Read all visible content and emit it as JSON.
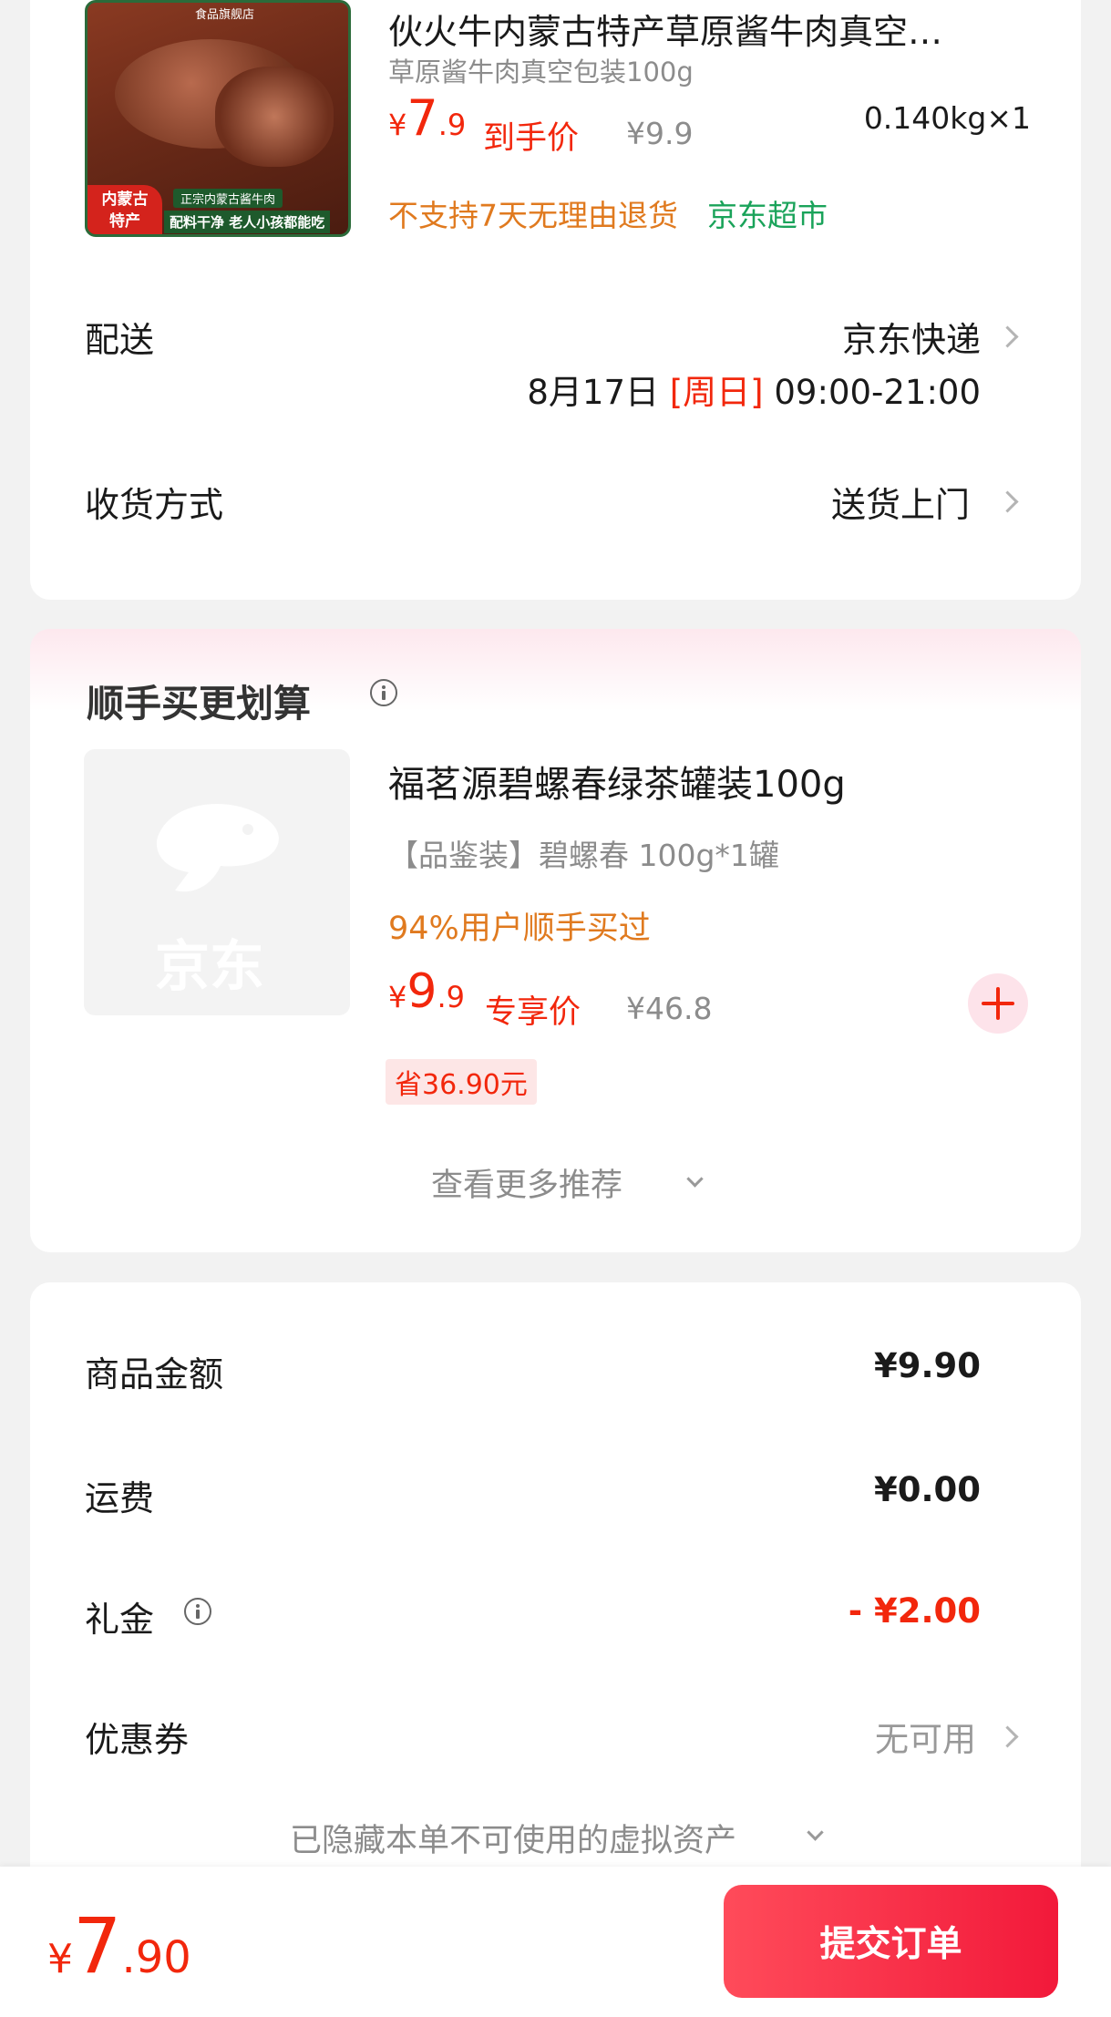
{
  "product": {
    "title": "伙火牛内蒙古特产草原酱牛肉真空…",
    "spec": "草原酱牛肉真空包装100g",
    "price_symbol": "¥",
    "price_int": "7",
    "price_dec": ".9",
    "price_tag": "到手价",
    "original_price": "¥9.9",
    "weight_qty": "0.140kg×1",
    "return_policy": "不支持7天无理由退货",
    "store_tag": "京东超市",
    "image": {
      "store_label": "食品旗舰店",
      "badge": "内蒙古\n特产",
      "line1": "正宗内蒙古酱牛肉",
      "line2": "配料干净 老人小孩都能吃"
    }
  },
  "delivery": {
    "label": "配送",
    "carrier": "京东快递",
    "date": "8月17日",
    "weekday": "[周日]",
    "time": "09:00-21:00"
  },
  "receive": {
    "label": "收货方式",
    "value": "送货上门"
  },
  "addon": {
    "title": "顺手买更划算",
    "name": "福茗源碧螺春绿茶罐装100g",
    "spec": "【品鉴装】碧螺春 100g*1罐",
    "popularity": "94%用户顺手买过",
    "price_symbol": "¥",
    "price_int": "9",
    "price_dec": ".9",
    "price_tag": "专享价",
    "original_price": "¥46.8",
    "saving": "省36.90元",
    "placeholder_text": "京东",
    "more": "查看更多推荐"
  },
  "summary": {
    "goods_label": "商品金额",
    "goods_value": "¥9.90",
    "shipping_label": "运费",
    "shipping_value": "¥0.00",
    "gift_label": "礼金",
    "gift_value": "- ¥2.00",
    "coupon_label": "优惠券",
    "coupon_value": "无可用",
    "hidden_assets": "已隐藏本单不可使用的虚拟资产"
  },
  "footer": {
    "price_symbol": "¥",
    "price_int": "7",
    "price_dec": ".90",
    "submit": "提交订单"
  },
  "colors": {
    "accent_red": "#f2270c",
    "orange": "#e07a1f",
    "green": "#1aa35a"
  }
}
